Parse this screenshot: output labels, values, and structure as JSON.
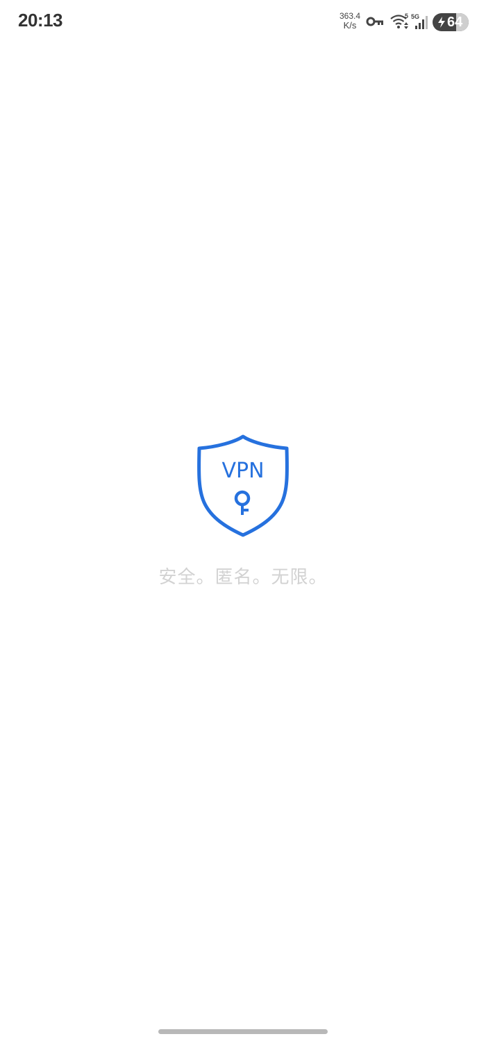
{
  "status_bar": {
    "time": "20:13",
    "net_speed_value": "363.4",
    "net_speed_unit": "K/s",
    "icons": [
      "vpn-key-icon",
      "wifi-icon",
      "signal-5g-icon",
      "battery-charging-icon"
    ],
    "wifi_label": "5",
    "signal_label": "5G",
    "battery_level": "64",
    "battery_fraction": 0.64
  },
  "splash": {
    "logo_text": "VPN",
    "tagline": "安全。匿名。无限。"
  },
  "colors": {
    "brand": "#2671de",
    "tagline": "#d2d2d2",
    "status_text": "#333333"
  }
}
